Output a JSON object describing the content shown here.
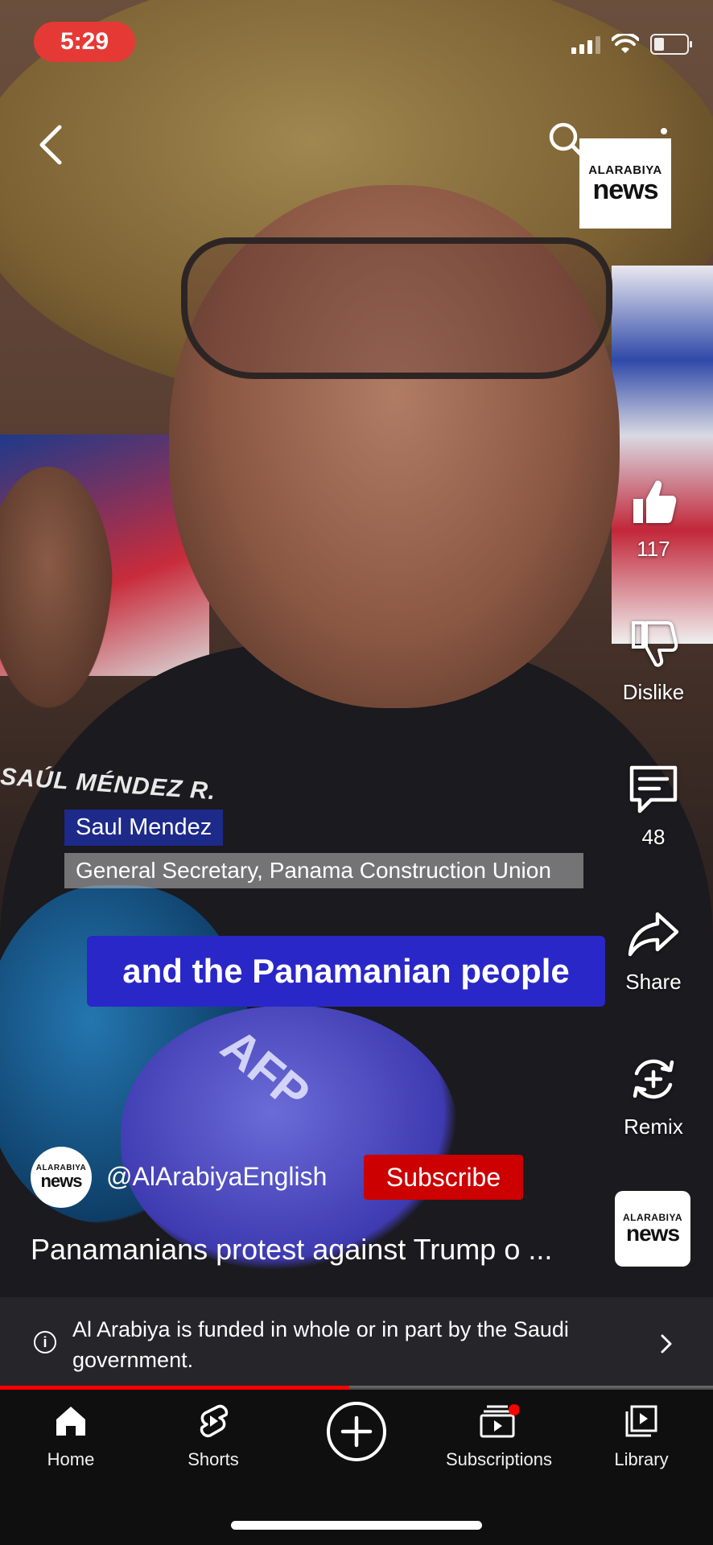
{
  "status_bar": {
    "time": "5:29"
  },
  "top_bar": {
    "back_icon": "chevron-left-icon",
    "search_icon": "search-icon",
    "more_icon": "more-vertical-icon"
  },
  "brand_logo": {
    "line1": "ALARABIYA",
    "line2": "news"
  },
  "video_overlay": {
    "shirt_text": "SAÚL MÉNDEZ R.",
    "mic_text": "AFP",
    "name": "Saul Mendez",
    "title": "General Secretary, Panama Construction Union",
    "caption": "and the Panamanian people"
  },
  "actions": {
    "like_count": "117",
    "dislike_label": "Dislike",
    "comments_count": "48",
    "share_label": "Share",
    "remix_label": "Remix"
  },
  "channel": {
    "handle": "@AlArabiyaEnglish",
    "subscribe_label": "Subscribe"
  },
  "video_title": "Panamanians protest against Trump o ...",
  "funding_notice": "Al Arabiya is funded in whole or in part by the Saudi government.",
  "progress": {
    "fraction": 0.49
  },
  "nav": [
    {
      "label": "Home",
      "icon": "home-icon"
    },
    {
      "label": "Shorts",
      "icon": "shorts-icon"
    },
    {
      "label": "",
      "icon": "create-icon"
    },
    {
      "label": "Subscriptions",
      "icon": "subscriptions-icon"
    },
    {
      "label": "Library",
      "icon": "library-icon"
    }
  ],
  "colors": {
    "accent_red": "#cc0000",
    "caption_blue": "#2a27c8",
    "name_tag_blue": "#1d2a8a"
  }
}
